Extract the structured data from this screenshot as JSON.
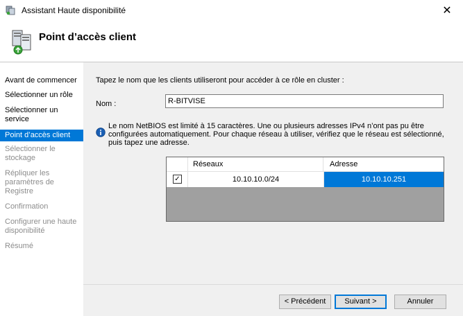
{
  "window": {
    "title": "Assistant Haute disponibilité",
    "close_glyph": "✕"
  },
  "header": {
    "title": "Point d’accès client",
    "icon": "cluster-wizard-icon"
  },
  "sidebar": {
    "items": [
      {
        "label": "Avant de commencer",
        "state": "normal"
      },
      {
        "label": "Sélectionner un rôle",
        "state": "normal"
      },
      {
        "label": "Sélectionner un service",
        "state": "normal"
      },
      {
        "label": "Point d’accès client",
        "state": "active"
      },
      {
        "label": "Sélectionner le stockage",
        "state": "disabled"
      },
      {
        "label": "Répliquer les paramètres de Registre",
        "state": "disabled"
      },
      {
        "label": "Confirmation",
        "state": "disabled"
      },
      {
        "label": "Configurer une haute disponibilité",
        "state": "disabled"
      },
      {
        "label": "Résumé",
        "state": "disabled"
      }
    ]
  },
  "main": {
    "instruction": "Tapez le nom que les clients utiliseront pour accéder à ce rôle en cluster :",
    "name_label": "Nom :",
    "name_value": "R-BITVISE",
    "info_text": "Le nom NetBIOS est limité à 15 caractères.  Une ou plusieurs adresses IPv4 n’ont pas pu être configurées automatiquement. Pour chaque réseau à utiliser, vérifiez que le réseau est sélectionné, puis tapez une adresse.",
    "grid": {
      "columns": [
        "Réseaux",
        "Adresse"
      ],
      "rows": [
        {
          "checked": true,
          "check_glyph": "✓",
          "network": "10.10.10.0/24",
          "address": "10.10.10.251"
        }
      ]
    }
  },
  "buttons": {
    "prev": "< Précédent",
    "next": "Suivant >",
    "cancel": "Annuler"
  },
  "colors": {
    "accent": "#0078d7",
    "panel": "#f0f0f0",
    "grid_empty": "#a0a0a0"
  }
}
